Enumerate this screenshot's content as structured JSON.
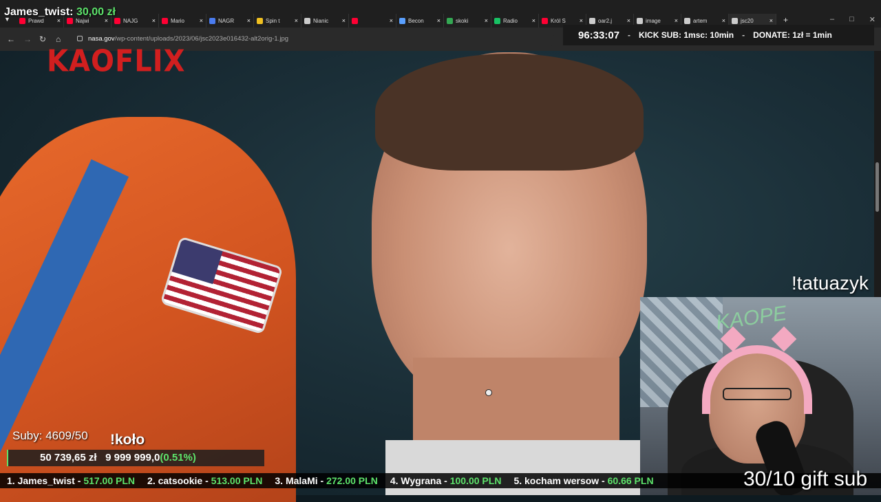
{
  "browser": {
    "tabs": [
      {
        "label": "Prawd",
        "icon": "youtube-icon",
        "color": "#ff0033"
      },
      {
        "label": "Najwi",
        "icon": "youtube-icon",
        "color": "#ff0033"
      },
      {
        "label": "NAJG",
        "icon": "youtube-icon",
        "color": "#ff0033"
      },
      {
        "label": "Mario",
        "icon": "youtube-icon",
        "color": "#ff0033"
      },
      {
        "label": "NAGR",
        "icon": "doc-icon",
        "color": "#4a7cf0"
      },
      {
        "label": "Spin t",
        "icon": "app-icon",
        "color": "#f0c020"
      },
      {
        "label": "Nianic",
        "icon": "page-icon",
        "color": "#cccccc"
      },
      {
        "label": "",
        "icon": "youtube-icon",
        "color": "#ff0033"
      },
      {
        "label": "Becon",
        "icon": "page-icon",
        "color": "#5aa0ff"
      },
      {
        "label": "skoki",
        "icon": "drive-icon",
        "color": "#34a853"
      },
      {
        "label": "Radio",
        "icon": "dot-icon",
        "color": "#18c264"
      },
      {
        "label": "Król S",
        "icon": "youtube-icon",
        "color": "#ff0033"
      },
      {
        "label": "oar2.j",
        "icon": "page-icon",
        "color": "#cccccc"
      },
      {
        "label": "image",
        "icon": "globe-icon",
        "color": "#cccccc"
      },
      {
        "label": "artem",
        "icon": "google-icon",
        "color": "#cccccc"
      },
      {
        "label": "jsc20",
        "icon": "page-icon",
        "color": "#cccccc"
      }
    ],
    "url_host": "nasa.gov",
    "url_path": "/wp-content/uploads/2023/06/jsc2023e016432-alt2orig-1.jpg"
  },
  "overlay": {
    "donor_name": "James_twist:",
    "donor_amount": "30,00 zł",
    "timer": "96:33:07",
    "kick_sub": "KICK SUB: 1msc: 10min",
    "donate": "DONATE: 1zł = 1min",
    "brand": "KAOFLIX",
    "command": "!tatuazyk",
    "subs": "Suby: 4609/50",
    "kolo": "!koło",
    "goal_current": "50 739,65 zł",
    "goal_target": "9 999 999,0",
    "goal_pct": "(0.51%)",
    "gift_sub": "30/10 gift sub",
    "webcam_graffiti": "KAOPE"
  },
  "ticker": [
    {
      "rank": "1.",
      "name": "James_twist",
      "value": "517.00 PLN"
    },
    {
      "rank": "2.",
      "name": "catsookie",
      "value": "513.00 PLN"
    },
    {
      "rank": "3.",
      "name": "MalaMi",
      "value": "272.00 PLN"
    },
    {
      "rank": "4.",
      "name": "Wygrana",
      "value": "100.00 PLN"
    },
    {
      "rank": "5.",
      "name": "kocham wersow",
      "value": "60.66 PLN"
    }
  ]
}
